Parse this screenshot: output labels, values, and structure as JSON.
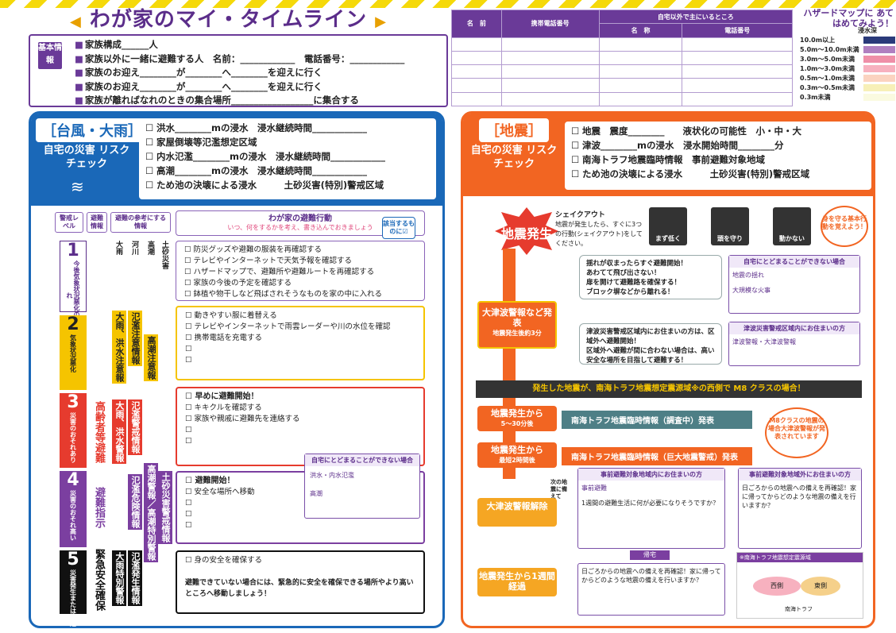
{
  "title": "わが家のマイ・タイムライン",
  "basic": {
    "tag": "基本情報",
    "rows": [
      "家族構成______人",
      "家族以外に一緒に避難する人　名前：____________　電話番号：____________",
      "家族のお迎え________が________へ________を迎えに行く",
      "家族のお迎え________が________へ________を迎えに行く",
      "家族が離ればなれのときの集合場所__________________に集合する"
    ]
  },
  "contacts": {
    "h1": "名　前",
    "h2": "携帯電話番号",
    "h3": "自宅以外で主にいるところ",
    "h4": "名　称",
    "h5": "電話番号"
  },
  "hazard": {
    "title": "ハザードマップに あてはめてみよう！",
    "depth": "浸水深",
    "legend": [
      {
        "label": "10.0m以上",
        "color": "#2a3a7a"
      },
      {
        "label": "5.0m～10.0m未満",
        "color": "#b07fc0"
      },
      {
        "label": "3.0m～5.0m未満",
        "color": "#ef8fa8"
      },
      {
        "label": "1.0m～3.0m未満",
        "color": "#f7b1bf"
      },
      {
        "label": "0.5m～1.0m未満",
        "color": "#fbd3c0"
      },
      {
        "label": "0.3m～0.5m未満",
        "color": "#f7f0b8"
      },
      {
        "label": "0.3m未満",
        "color": "#fafae0"
      }
    ]
  },
  "typhoon": {
    "title": "［台風・大雨］",
    "sub": "自宅の災害 リスクチェック",
    "checks": [
      "洪水________mの浸水　浸水継続時間____________",
      "家屋倒壊等氾濫想定区域",
      "内水氾濫________mの浸水　浸水継続時間____________",
      "高潮________mの浸水　浸水継続時間____________",
      "ため池の決壊による浸水　　　土砂災害(特別)警戒区域"
    ],
    "colh": [
      "警戒レベル",
      "避難情報",
      "避難の参考にする情報"
    ],
    "action_title": "わが家の避難行動",
    "action_sub": "いつ、何をするかを考え、書き込んでおきましょう",
    "ifapply": "該当するものに☑",
    "box1": [
      "防災グッズや避難の服装を再確認する",
      "テレビやインターネットで天気予報を確認する",
      "ハザードマップで、避難所や避難ルートを再確認する",
      "家族の今後の予定を確認する",
      "鉢植や物干しなど飛ばされそうなものを家の中に入れる"
    ],
    "box2": [
      "動きやすい服に着替える",
      "テレビやインターネットで雨雲レーダーや川の水位を確認",
      "携帯電話を充電する",
      "",
      ""
    ],
    "box3h": "早めに避難開始！",
    "box3": [
      "キキクルを確認する",
      "家族や親戚に避難先を連絡する",
      "",
      ""
    ],
    "box4h": "避難開始！",
    "box4": [
      "安全な場所へ移動",
      "",
      "",
      ""
    ],
    "box5": "身の安全を確保する",
    "box5note": "避難できていない場合には、緊急的に安全を確保できる場所やより高いところへ移動しましょう！",
    "stay_title": "自宅にとどまることができない場合",
    "stay1": "洪水・内水氾濫",
    "stay2": "高潮",
    "levels": [
      {
        "n": "1",
        "t": "今後気象状況悪化のおそれ"
      },
      {
        "n": "2",
        "t": "気象状況悪化"
      },
      {
        "n": "3",
        "t": "災害のおそれあり"
      },
      {
        "n": "4",
        "t": "災害のおそれ高い"
      },
      {
        "n": "5",
        "t": "災害発生または切迫"
      }
    ],
    "evac": [
      "高齢者等避難",
      "避難指示",
      "緊急安全確保"
    ],
    "ref": [
      "大雨",
      "河川",
      "高潮",
      "土砂災害",
      "大雨、洪水注意報",
      "氾濫注意情報",
      "高潮注意報",
      "大雨、洪水警報",
      "氾濫警戒情報",
      "高潮警報／高潮特別警報",
      "土砂災害警戒情報",
      "氾濫危険情報",
      "大雨特別警報",
      "氾濫発生情報"
    ]
  },
  "quake": {
    "title": "［地震］",
    "sub": "自宅の災害 リスクチェック",
    "checks": [
      "地震　震度________　　液状化の可能性　小・中・大",
      "津波________mの浸水　浸水開始時間________分",
      "南海トラフ地震臨時情報　事前避難対象地域",
      "ため池の決壊による浸水　　　土砂災害(特別)警戒区域"
    ],
    "occur": "地震発生",
    "shakeout": "シェイクアウト",
    "shakeout_text": "地震が発生したら、すぐに3つの行動(シェイクアウト)をしてください。",
    "steps": [
      "まず低く",
      "頭を守り",
      "動かない"
    ],
    "protect": "身を守る基本行動を覚えよう！",
    "after": [
      "揺れが収まったらすぐ避難開始！",
      "あわてて飛び出さない！",
      "扉を開けて避難路を確保する！",
      "ブロック塀などから離れる！"
    ],
    "tsunami": "大津波警報など発表",
    "tsunami_time": "地震発生後約3分",
    "tsunami_text": [
      "津波災害警戒区域内にお住まいの方は、区域外へ避難開始！",
      "区域外へ避難が間に合わない場合は、高い安全な場所を目指して避難する！"
    ],
    "card1": "自宅にとどまることができない場合",
    "card1a": "地震の揺れ",
    "card1b": "大規模な火事",
    "card2": "津波災害警戒区域内にお住まいの方",
    "card2a": "津波警報・大津波警報",
    "banner": "発生した地震が、南海トラフ地震想定震源域※の西側で M8 クラスの場合！",
    "t1": "地震発生から",
    "t1s": "5～30分後",
    "i1": "南海トラフ地震臨時情報（調査中）発表",
    "t2": "地震発生から",
    "t2s": "最短2時間後",
    "i2": "南海トラフ地震臨時情報（巨大地震警戒）発表",
    "m8": "M8クラスの地震の場合大津波警報が発表されています",
    "next": "次の地震に備えて",
    "t3": "大津波警報解除",
    "t4": "地震発生から1週間経過",
    "c3": "事前避難対象地域内にお住まいの方",
    "c3a": "事前避難",
    "c3b": "1週間の避難生活に何が必要になりそうですか？",
    "c4": "事前避難対象地域外にお住まいの方",
    "c4a": "日ごろからの地震への備えを再確認！家に帰ってからどのような地震の備えを行いますか？",
    "home": "帰宅",
    "c5": "日ごろからの地震への備えを再確認！家に帰ってからどのような地震の備えを行いますか？",
    "map_title": "※南海トラフ地震想定震源域",
    "map_w": "西側",
    "map_e": "東側",
    "map_t": "南海トラフ"
  }
}
